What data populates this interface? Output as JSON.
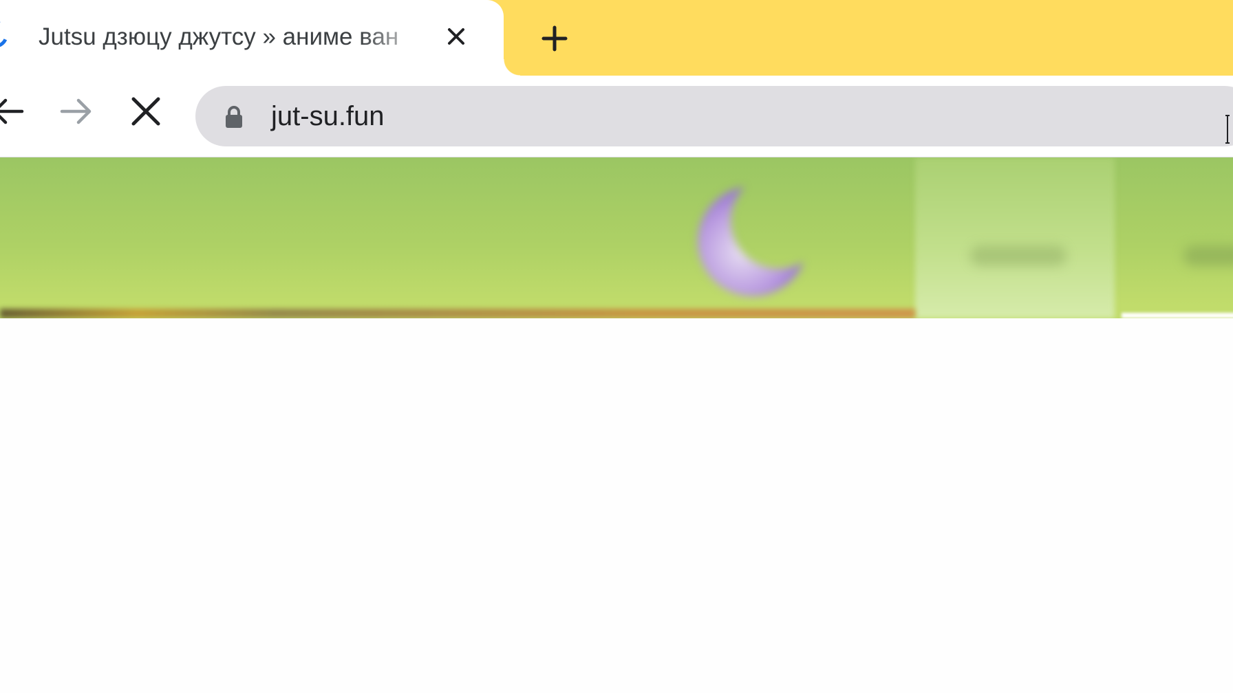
{
  "browser": {
    "tab": {
      "title": "Jutsu дзюцу джутсу » аниме ван",
      "loading": true,
      "spinner_icon": "loading-spinner-icon",
      "close_icon": "close-icon"
    },
    "new_tab_icon": "plus-icon",
    "tab_strip_color": "#ffdc5e",
    "toolbar": {
      "back_icon": "arrow-left-icon",
      "forward_icon": "arrow-right-icon",
      "stop_icon": "close-icon"
    },
    "address_bar": {
      "url": "jut-su.fun",
      "secure_icon": "lock-icon"
    }
  },
  "page": {
    "header": {
      "logo_icon": "crescent-moon-icon",
      "accent_color": "#aed165"
    }
  }
}
